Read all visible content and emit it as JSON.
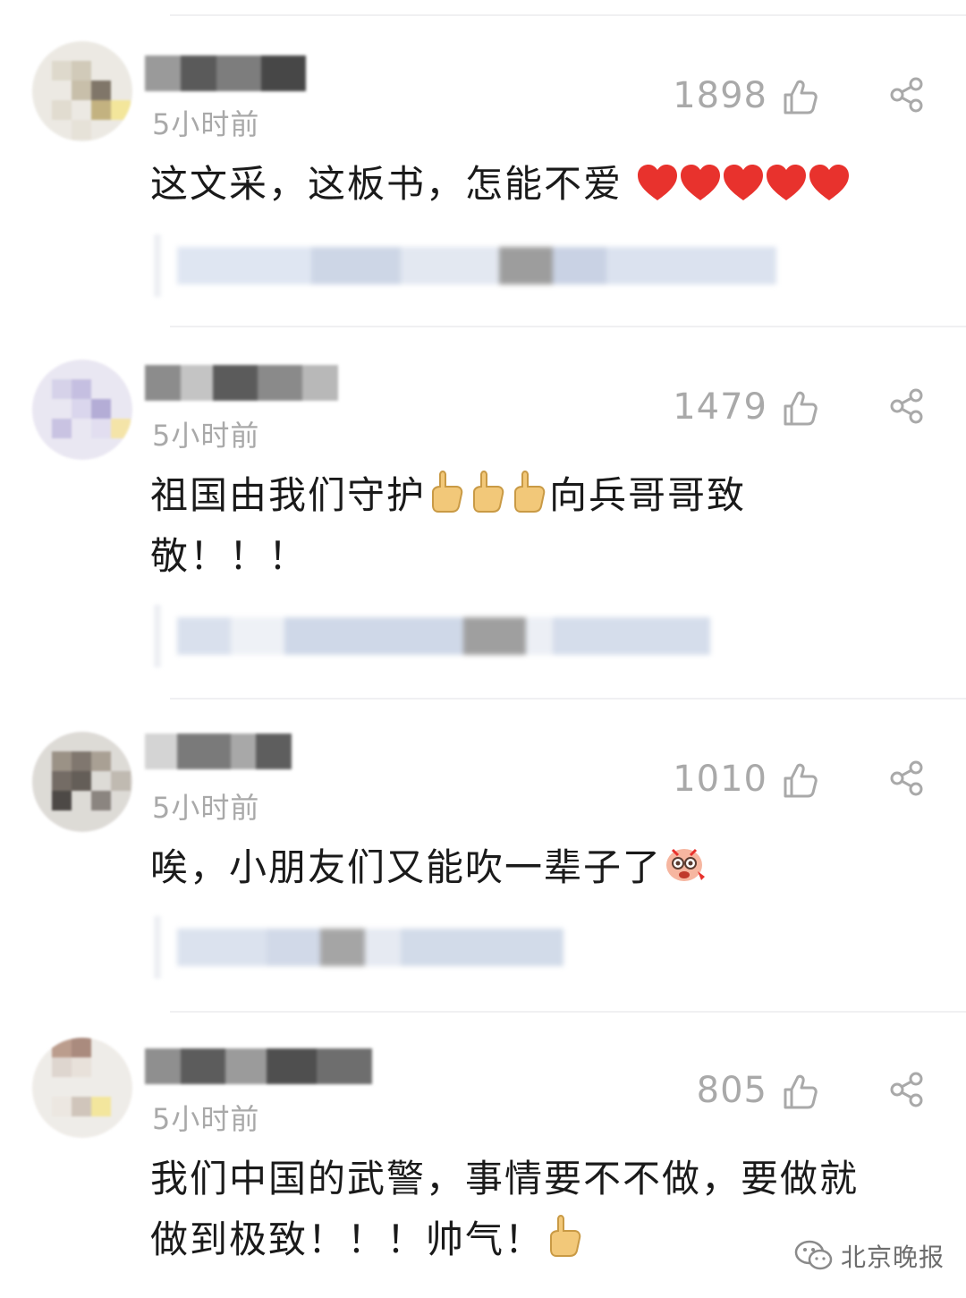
{
  "comments": [
    {
      "time": "5小时前",
      "likes": "1898",
      "text": "这文采，这板书，怎能不爱",
      "emoji": "heart-icon",
      "emoji_count": 5
    },
    {
      "time": "5小时前",
      "likes": "1479",
      "text_a": "祖国由我们守护",
      "text_b": "向兵哥哥致",
      "text_c": "敬！！！",
      "emoji": "thumbs-up-icon",
      "emoji_count": 3
    },
    {
      "time": "5小时前",
      "likes": "1010",
      "text": "唉，小朋友们又能吹一辈子了",
      "emoji": "laughing-face-icon"
    },
    {
      "time": "5小时前",
      "likes": "805",
      "text_line1": "我们中国的武警，事情要不不做，要做就",
      "text_line2": "做到极致！！！帅气！",
      "emoji": "thumbs-up-icon"
    }
  ],
  "watermark": {
    "text": "北京晚报",
    "icon": "wechat-icon"
  },
  "colors": {
    "meta_gray": "#a9a9a9",
    "text_dark": "#1a1a1a",
    "heart_red": "#e8322d",
    "thumb_yellow": "#f2c879"
  }
}
